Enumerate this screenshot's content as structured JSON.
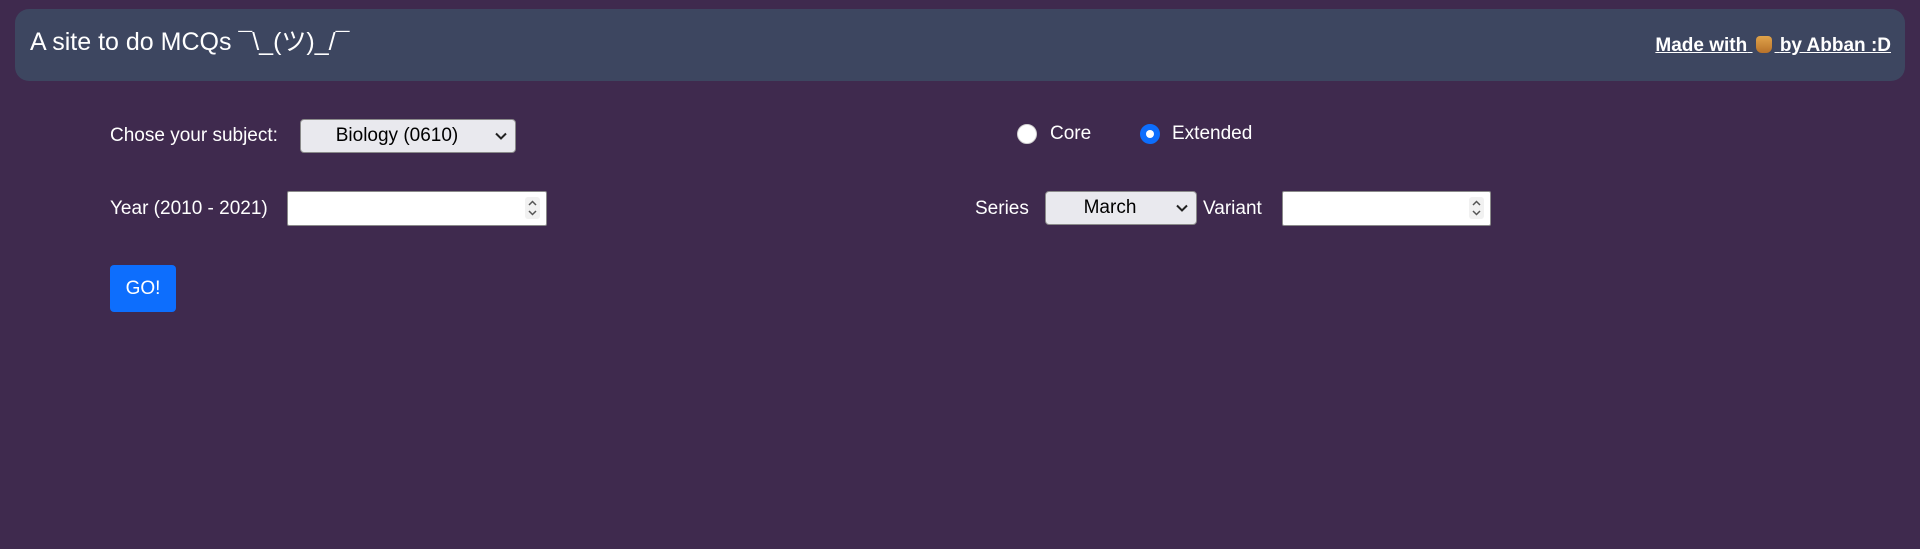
{
  "header": {
    "title": "A site to do MCQs ¯\\_(ツ)_/¯",
    "credit_prefix": "Made with",
    "credit_icon": "heart-icon",
    "credit_suffix": "by Abban :D"
  },
  "form": {
    "subject": {
      "label": "Chose your subject:",
      "selected": "Biology (0610)"
    },
    "level": {
      "options": [
        {
          "label": "Core",
          "checked": false
        },
        {
          "label": "Extended",
          "checked": true
        }
      ]
    },
    "year": {
      "label": "Year (2010 - 2021)",
      "value": ""
    },
    "series": {
      "label": "Series",
      "selected": "March"
    },
    "variant": {
      "label": "Variant",
      "value": ""
    },
    "go_label": "GO!"
  },
  "colors": {
    "background": "#3f2a4e",
    "navbar": "#3d4660",
    "accent": "#0d6efd"
  }
}
